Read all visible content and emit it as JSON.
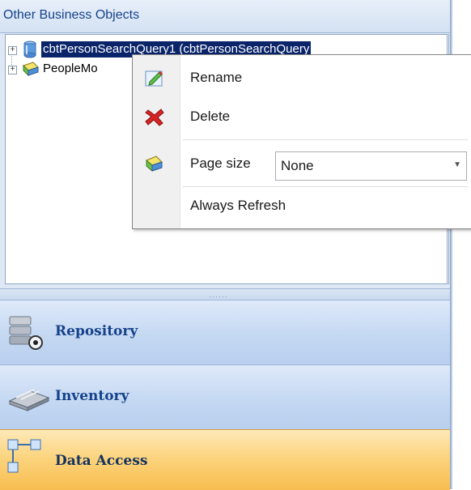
{
  "header": {
    "title": "Other Business Objects"
  },
  "tree": {
    "nodes": [
      {
        "label": "cbtPersonSearchQuery1 (cbtPersonSearchQuery",
        "selected": true,
        "icon": "database-icon"
      },
      {
        "label": "PeopleMo",
        "selected": false,
        "icon": "business-object-icon"
      }
    ]
  },
  "context_menu": {
    "items": [
      {
        "label": "Rename",
        "icon": "rename-icon"
      },
      {
        "label": "Delete",
        "icon": "delete-icon"
      },
      {
        "label": "Page size",
        "icon": "page-size-icon",
        "combo_value": "None"
      },
      {
        "label": "Always Refresh"
      }
    ]
  },
  "splitter": {
    "grip": "······"
  },
  "nav": {
    "buttons": [
      {
        "label": "Repository",
        "icon": "repository-icon",
        "active": false
      },
      {
        "label": "Inventory",
        "icon": "inventory-icon",
        "active": false
      },
      {
        "label": "Data Access",
        "icon": "data-access-icon",
        "active": true
      }
    ]
  },
  "colors": {
    "header_text": "#15428b",
    "selection": "#0a246a",
    "active_nav": "#f8bd4f"
  }
}
